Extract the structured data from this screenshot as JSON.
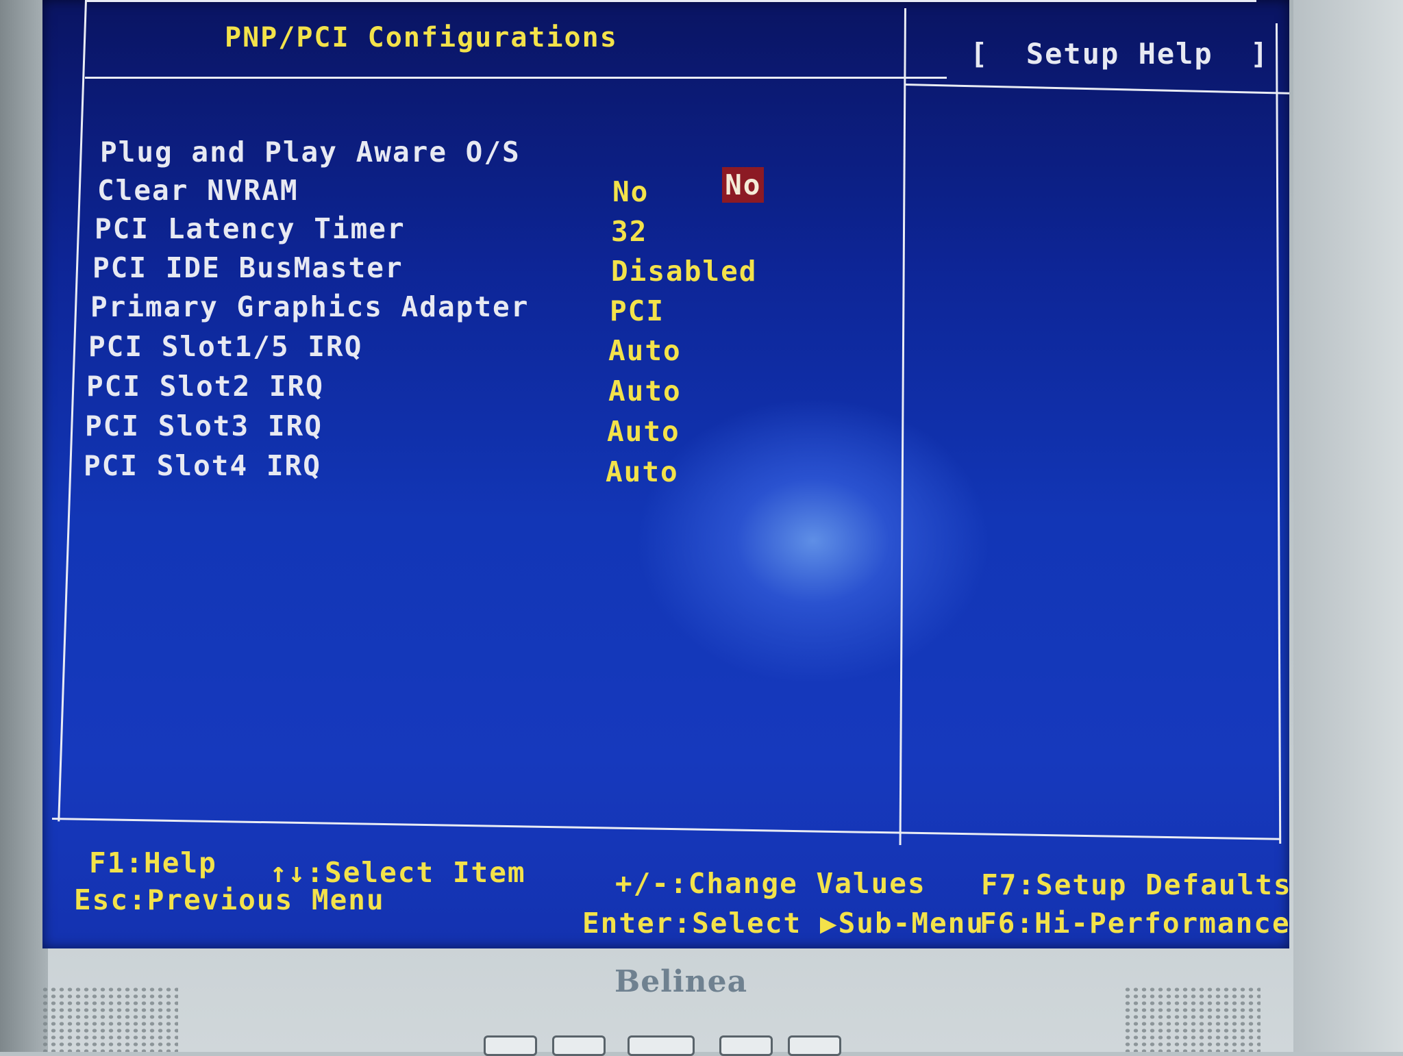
{
  "bios": {
    "title": "PNP/PCI Configurations",
    "help_title": "[  Setup Help  ]",
    "items": [
      {
        "label": "Plug and Play Aware O/S",
        "value": "No",
        "selected": true
      },
      {
        "label": "Clear NVRAM",
        "value": "No"
      },
      {
        "label": "PCI Latency Timer",
        "value": "32"
      },
      {
        "label": "PCI IDE BusMaster",
        "value": "Disabled"
      },
      {
        "label": "Primary Graphics Adapter",
        "value": "PCI"
      },
      {
        "label": "PCI Slot1/5 IRQ",
        "value": "Auto"
      },
      {
        "label": "PCI Slot2 IRQ",
        "value": "Auto"
      },
      {
        "label": "PCI Slot3 IRQ",
        "value": "Auto"
      },
      {
        "label": "PCI Slot4 IRQ",
        "value": "Auto"
      }
    ],
    "footer": {
      "f1": "F1:Help",
      "select_item": "↑↓:Select Item",
      "change_values": "+/-:Change Values",
      "f7": "F7:Setup Defaults",
      "esc": "Esc:Previous Menu",
      "enter": "Enter:Select ▶Sub-Menu",
      "f6": "F6:Hi-Performance"
    },
    "colors": {
      "background": "#1236b6",
      "text": "#f3e24a",
      "item_text": "#e7e9f2",
      "highlight": "#8c1a24"
    }
  },
  "monitor": {
    "brand": "Belinea"
  }
}
